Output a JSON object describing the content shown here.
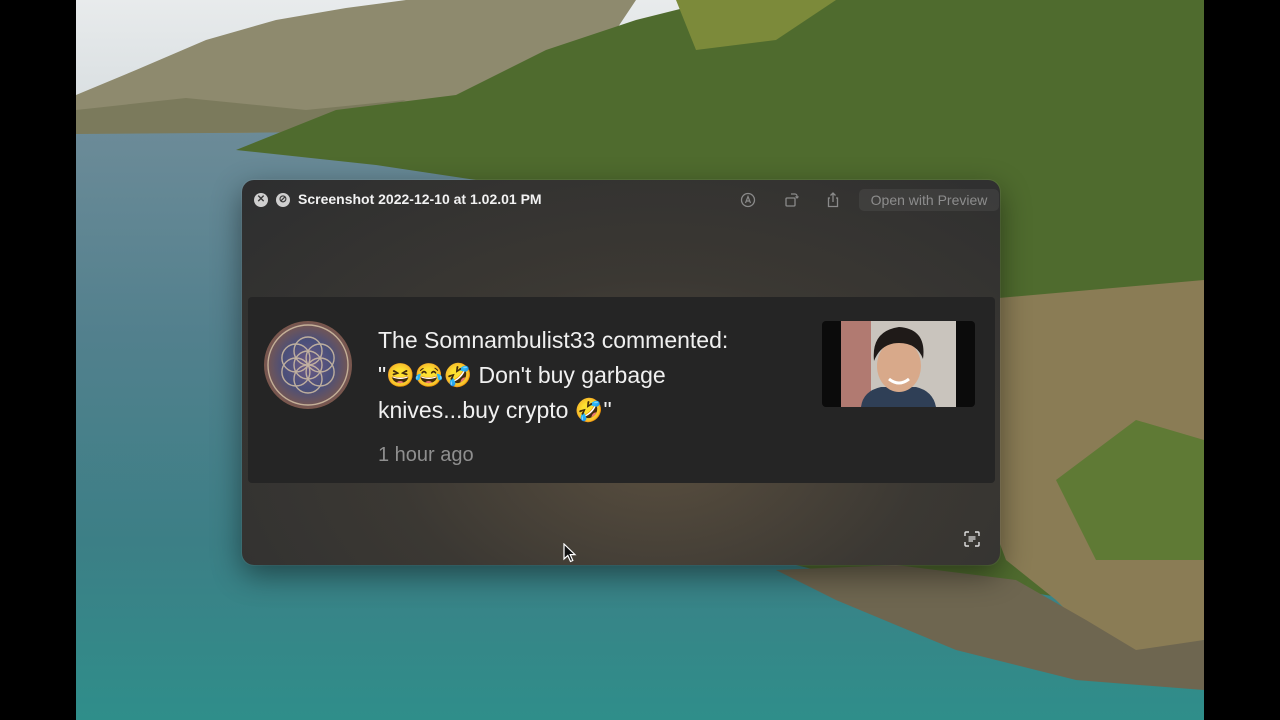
{
  "window": {
    "title": "Screenshot 2022-12-10 at 1.02.01 PM",
    "open_with_preview": "Open with Preview",
    "toolbar_icons": [
      "markup-icon",
      "rotate-icon",
      "share-icon"
    ],
    "live_text_icon": "live-text-icon"
  },
  "notification": {
    "line1": "The Somnambulist33 commented:",
    "line2": "\"😆😂🤣 Don't buy garbage",
    "line3": "knives...buy crypto 🤣\"",
    "time": "1 hour ago"
  },
  "colors": {
    "card_bg": "#252525",
    "window_bg": "#2d2e2f",
    "text_primary": "#f0f0f0",
    "text_secondary": "#8f8f8f"
  }
}
